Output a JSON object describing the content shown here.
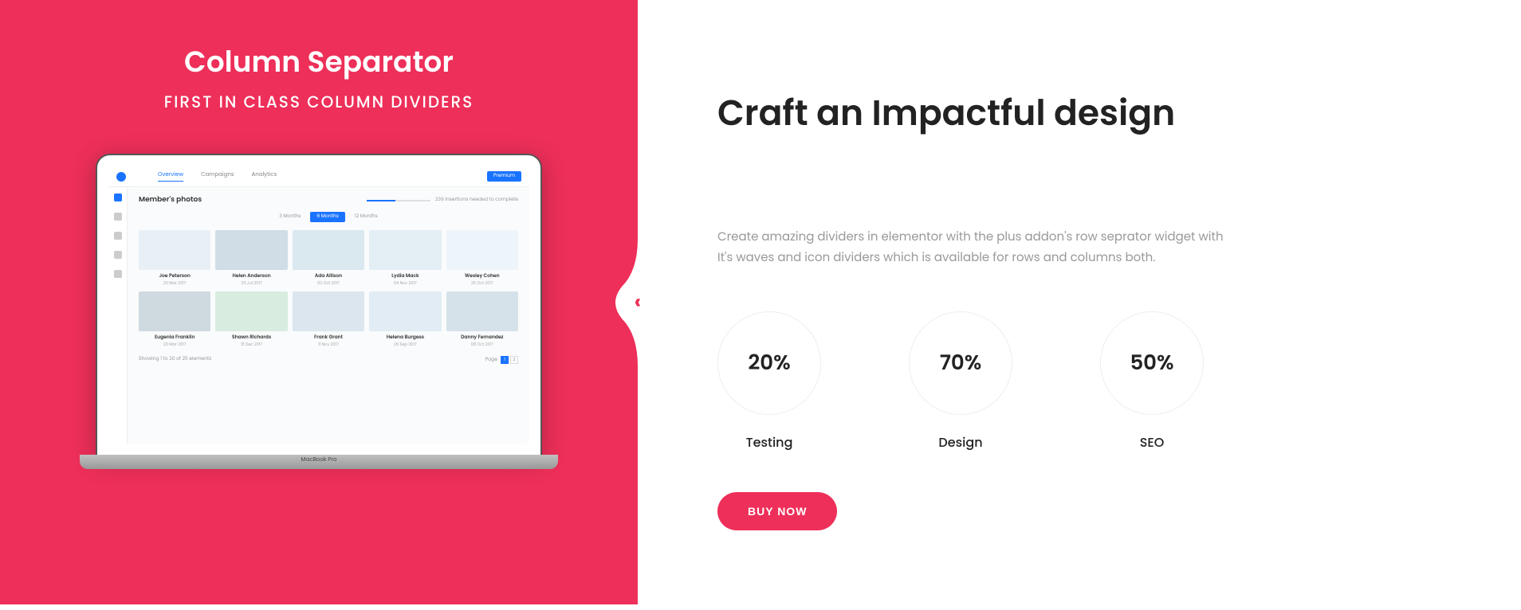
{
  "left": {
    "title": "Column Separator",
    "subtitle": "FIRST IN CLASS COLUMN DIVIDERS"
  },
  "laptop_label": "MacBook Pro",
  "app": {
    "tabs": [
      "Overview",
      "Campaigns",
      "Analytics"
    ],
    "active_tab": 0,
    "premium_label": "Premium",
    "main_title": "Member's photos",
    "progress_text": "239 insertions needed to complete",
    "time_filters": [
      "3 Months",
      "6 Months",
      "12 Months"
    ],
    "active_filter": 1,
    "photos": [
      {
        "name": "Joe Peterson",
        "date": "20 Mar 2017"
      },
      {
        "name": "Helen Anderson",
        "date": "03 Jul 2017"
      },
      {
        "name": "Ada Allison",
        "date": "02 Oct 2017"
      },
      {
        "name": "Lydia Mack",
        "date": "04 Nov 2017"
      },
      {
        "name": "Wesley Cohen",
        "date": "25 Oct 2017"
      },
      {
        "name": "Eugenia Franklin",
        "date": "20 Mar 2017"
      },
      {
        "name": "Shawn Richards",
        "date": "31 Dec 2017"
      },
      {
        "name": "Frank Grant",
        "date": "11 Nov 2017"
      },
      {
        "name": "Helena Burgess",
        "date": "29 Sep 2017"
      },
      {
        "name": "Danny Fernandez",
        "date": "08 Oct 2017"
      }
    ],
    "footer_text": "Showing 1 to 20 of 25 elements",
    "page_label": "Page",
    "current_page": "1",
    "pages": [
      "1",
      "2"
    ]
  },
  "right": {
    "title": "Craft an Impactful design",
    "description": "Create amazing dividers in elementor with the plus addon's row seprator widget with It's waves and icon dividers which is available for rows and columns both.",
    "stats": [
      {
        "value": "20%",
        "label": "Testing"
      },
      {
        "value": "70%",
        "label": "Design"
      },
      {
        "value": "50%",
        "label": "SEO"
      }
    ],
    "buy_label": "BUY NOW"
  },
  "separator_icon": "‹"
}
